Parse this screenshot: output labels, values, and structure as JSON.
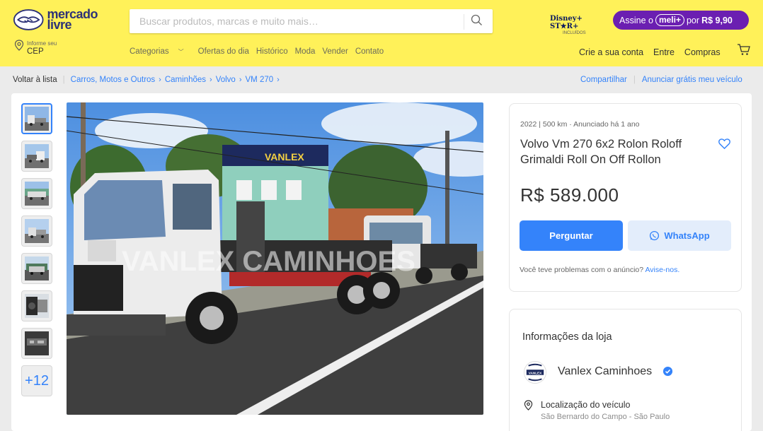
{
  "header": {
    "logo_line1": "mercado",
    "logo_line2": "livre",
    "search_placeholder": "Buscar produtos, marcas e muito mais…",
    "disney_brand": "Disney+ ST★R+",
    "disney_sub": "INCLUÍDOS",
    "meli_prefix": "Assine o",
    "meli_badge": "meli+",
    "meli_middle": "por",
    "meli_price": "R$ 9,90",
    "cep_small": "Informe seu",
    "cep_main": "CEP",
    "nav": [
      "Categorias",
      "Ofertas do dia",
      "Histórico",
      "Moda",
      "Vender",
      "Contato"
    ],
    "user_nav": [
      "Crie a sua conta",
      "Entre",
      "Compras"
    ]
  },
  "breadcrumb": {
    "back": "Voltar à lista",
    "items": [
      "Carros, Motos e Outros",
      "Caminhões",
      "Volvo",
      "VM 270"
    ],
    "share": "Compartilhar",
    "announce": "Anunciar grátis meu veículo"
  },
  "gallery": {
    "more_label": "+12",
    "watermark": "VANLEX CAMINHOES",
    "store_sign": "VANLEX"
  },
  "listing": {
    "subtitle": "2022 | 500 km · Anunciado há 1 ano",
    "title": "Volvo Vm 270 6x2 Rolon Roloff Grimaldi Roll On Off Rollon",
    "price": "R$ 589.000",
    "ask_button": "Perguntar",
    "whatsapp_button": "WhatsApp",
    "report_text": "Você teve problemas com o anúncio?",
    "report_link": "Avise-nos."
  },
  "store": {
    "heading": "Informações da loja",
    "logo_text": "VANLEX",
    "name": "Vanlex Caminhoes",
    "location_label": "Localização do veículo",
    "location_value": "São Bernardo do Campo - São Paulo"
  },
  "colors": {
    "header_bg": "#fff159",
    "accent_blue": "#3483fa",
    "meli_purple": "#6b1fb1",
    "page_bg": "#ebebeb"
  }
}
